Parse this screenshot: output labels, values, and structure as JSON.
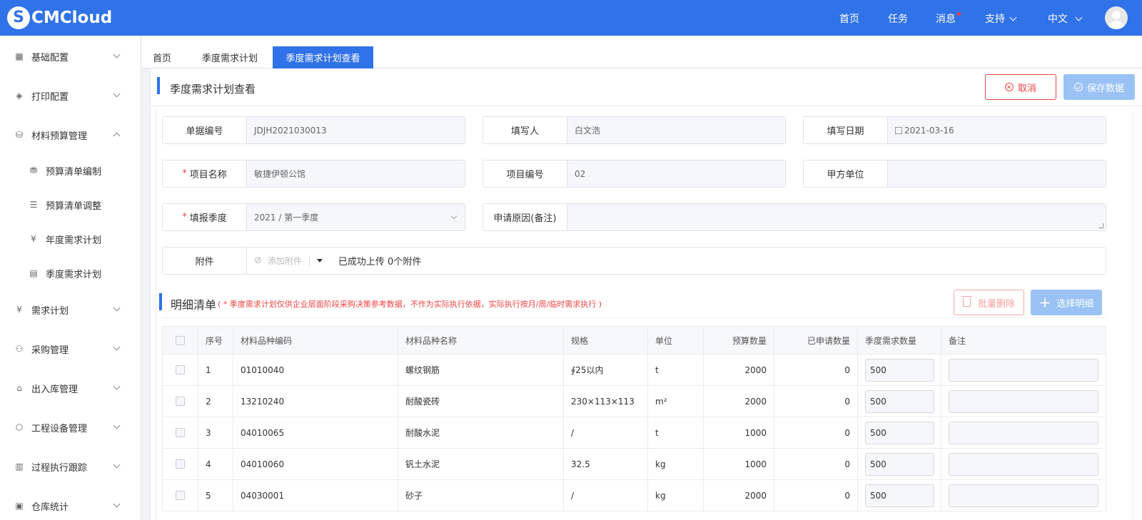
{
  "topbar": {
    "logo_text": "CMCloud",
    "nav": {
      "home": "首页",
      "tasks": "任务",
      "messages": "消息",
      "support": "支持",
      "language": "中文"
    }
  },
  "sidebar": {
    "items": [
      {
        "label": "基础配置",
        "icon": "grid-icon"
      },
      {
        "label": "打印配置",
        "icon": "layers-icon"
      },
      {
        "label": "材料预算管理",
        "icon": "database-icon"
      },
      {
        "label": "预算清单编制",
        "icon": "coins-icon"
      },
      {
        "label": "预算清单调整",
        "icon": "list-icon"
      },
      {
        "label": "年度需求计划",
        "icon": "yen-doc-icon"
      },
      {
        "label": "季度需求计划",
        "icon": "calc-icon"
      },
      {
        "label": "需求计划",
        "icon": "yen-icon"
      },
      {
        "label": "采购管理",
        "icon": "org-icon"
      },
      {
        "label": "出入库管理",
        "icon": "home-icon"
      },
      {
        "label": "工程设备管理",
        "icon": "box-icon"
      },
      {
        "label": "过程执行跟踪",
        "icon": "tracking-icon"
      },
      {
        "label": "仓库统计",
        "icon": "warehouse-icon"
      }
    ]
  },
  "tabs": [
    "首页",
    "季度需求计划",
    "季度需求计划查看"
  ],
  "page": {
    "title": "季度需求计划查看",
    "cancel_label": "取消",
    "save_label": "保存数据"
  },
  "form": {
    "doc_no": {
      "label": "单据编号",
      "value": "JDJH2021030013"
    },
    "filler": {
      "label": "填写人",
      "value": "白文浩"
    },
    "fill_date": {
      "label": "填写日期",
      "value": "2021-03-16"
    },
    "project_name": {
      "label": "项目名称",
      "value": "敏捷伊顿公馆"
    },
    "project_no": {
      "label": "项目编号",
      "value": "02"
    },
    "party_a": {
      "label": "甲方单位",
      "value": ""
    },
    "quarter": {
      "label": "填报季度",
      "value": "2021 / 第一季度"
    },
    "reason": {
      "label": "申请原因(备注)",
      "value": ""
    },
    "attachment": {
      "label": "附件",
      "placeholder": "添加附件",
      "status": "已成功上传 0个附件"
    },
    "required_mark": "*"
  },
  "details": {
    "title": "明细清单",
    "note": "( * 季度需求计划仅供企业层面阶段采购决策参考数据，不作为实际执行依据，实际执行按月/周/临时需求执行 )",
    "batch_delete_label": "批量删除",
    "select_label": "选择明细",
    "columns": [
      "序号",
      "材料品种编码",
      "材料品种名称",
      "规格",
      "单位",
      "预算数量",
      "已申请数量",
      "季度需求数量",
      "备注"
    ],
    "rows": [
      {
        "no": "1",
        "code": "01010040",
        "name": "螺纹钢筋",
        "spec": "∮25以内",
        "unit": "t",
        "budget": "2000",
        "applied": "0",
        "qty": "500",
        "remark": ""
      },
      {
        "no": "2",
        "code": "13210240",
        "name": "耐酸瓷砖",
        "spec": "230×113×113",
        "unit": "m²",
        "budget": "2000",
        "applied": "0",
        "qty": "500",
        "remark": ""
      },
      {
        "no": "3",
        "code": "04010065",
        "name": "耐酸水泥",
        "spec": "/",
        "unit": "t",
        "budget": "1000",
        "applied": "0",
        "qty": "500",
        "remark": ""
      },
      {
        "no": "4",
        "code": "04010060",
        "name": "钒土水泥",
        "spec": "32.5",
        "unit": "kg",
        "budget": "1000",
        "applied": "0",
        "qty": "500",
        "remark": ""
      },
      {
        "no": "5",
        "code": "04030001",
        "name": "砂子",
        "spec": "/",
        "unit": "kg",
        "budget": "2000",
        "applied": "0",
        "qty": "500",
        "remark": ""
      }
    ]
  },
  "colors": {
    "primary": "#3072e8",
    "danger": "#ee4444",
    "disabled_primary": "#9ac2f5"
  }
}
